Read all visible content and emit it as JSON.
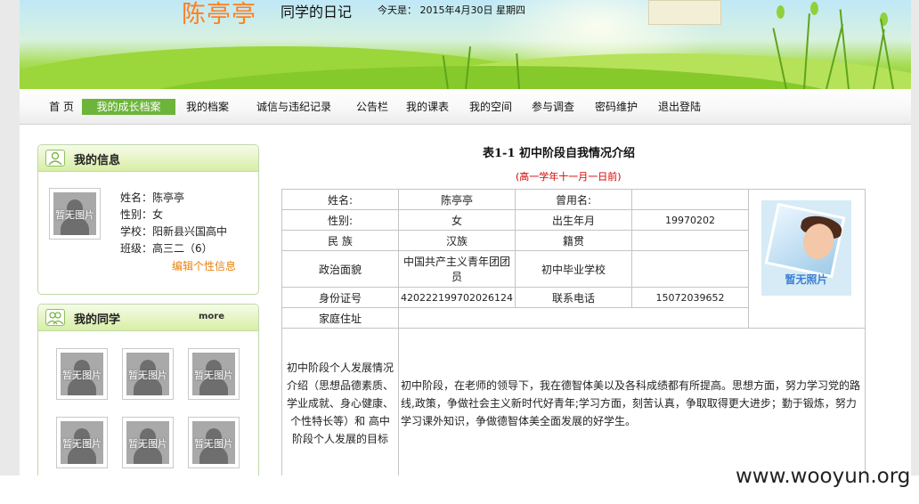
{
  "header": {
    "student_name": "陈亭亭",
    "diary_title": "同学的日记",
    "today": "今天是： 2015年4月30日 星期四"
  },
  "nav": {
    "items": [
      {
        "label": "首 页",
        "active": false
      },
      {
        "label": "我的成长档案",
        "active": true
      },
      {
        "label": "我的档案",
        "active": false
      },
      {
        "label": "诚信与违纪记录",
        "active": false
      },
      {
        "label": "公告栏",
        "active": false
      },
      {
        "label": "我的课表",
        "active": false
      },
      {
        "label": "我的空间",
        "active": false
      },
      {
        "label": "参与调查",
        "active": false
      },
      {
        "label": "密码维护",
        "active": false
      },
      {
        "label": "退出登陆",
        "active": false
      }
    ]
  },
  "my_info": {
    "title": "我的信息",
    "avatar_text": "暂无图片",
    "name": "姓名：陈亭亭",
    "gender": "性别：女",
    "school": "学校：阳新县兴国高中",
    "class": "班级：高三二（6）",
    "edit_link": "编辑个性信息"
  },
  "my_classmates": {
    "title": "我的同学",
    "more": "more",
    "avatars": [
      "暂无图片",
      "暂无图片",
      "暂无图片",
      "暂无图片",
      "暂无图片",
      "暂无图片"
    ]
  },
  "main": {
    "table_title": "表1-1  初中阶段自我情况介绍",
    "table_subtitle": "(高一学年十一月一日前)",
    "rows": {
      "name_label": "姓名:",
      "name_value": "陈亭亭",
      "former_name_label": "曾用名:",
      "former_name_value": "",
      "gender_label": "性别:",
      "gender_value": "女",
      "birth_label": "出生年月",
      "birth_value": "19970202",
      "ethnicity_label": "民 族",
      "ethnicity_value": "汉族",
      "origin_label": "籍贯",
      "origin_value": "",
      "political_label": "政治面貌",
      "political_value": "中国共产主义青年团团员",
      "middle_school_label": "初中毕业学校",
      "middle_school_value": "",
      "id_label": "身份证号",
      "id_value": "420222199702026124",
      "phone_label": "联系电话",
      "phone_value": "15072039652",
      "address_label": "家庭住址",
      "address_value": "",
      "development_label": "初中阶段个人发展情况介绍（思想品德素质、学业成就、身心健康、个性特长等）和 高中阶段个人发展的目标",
      "development_value": "初中阶段，在老师的领导下，我在德智体美以及各科成绩都有所提高。思想方面，努力学习党的路线,政策，争做社会主义新时代好青年;学习方面，刻苦认真，争取取得更大进步；勤于锻炼，努力学习课外知识，争做德智体美全面发展的好学生。"
    },
    "photo_caption": "暂无照片"
  },
  "watermark": "www.wooyun.org"
}
